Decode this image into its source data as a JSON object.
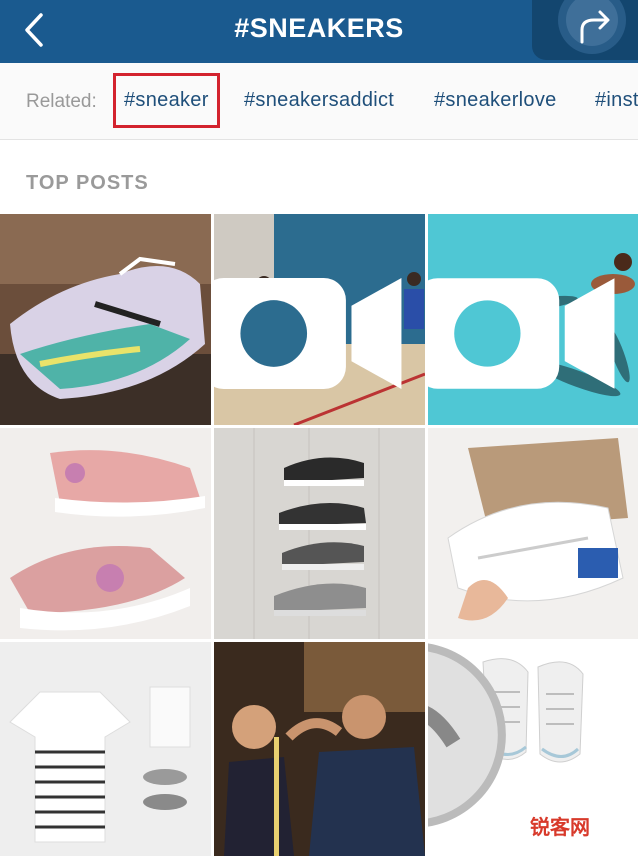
{
  "header": {
    "title": "#SNEAKERS",
    "back_icon": "chevron-left-icon",
    "share_icon": "share-arrow-icon"
  },
  "related": {
    "label": "Related:",
    "tags": [
      "#sneaker",
      "#sneakersaddict",
      "#sneakerlove",
      "#inst"
    ],
    "selected_index": 0
  },
  "section": {
    "title": "TOP POSTS"
  },
  "posts": [
    {
      "kind": "photo",
      "subject": "iridescent high-top sneakers"
    },
    {
      "kind": "video",
      "subject": "basketball gym"
    },
    {
      "kind": "video",
      "subject": "sharks in pool"
    },
    {
      "kind": "photo",
      "subject": "pink floral running shoes"
    },
    {
      "kind": "photo",
      "subject": "stacked black and grey sneakers"
    },
    {
      "kind": "photo",
      "subject": "white shell-toe sneakers"
    },
    {
      "kind": "photo",
      "subject": "striped tee flat lay"
    },
    {
      "kind": "photo",
      "subject": "tailor fitting suit"
    },
    {
      "kind": "photo",
      "subject": "white knit sneakers"
    }
  ],
  "watermark": {
    "text": "锐客网"
  },
  "colors": {
    "header": "#1a5a8f",
    "tag": "#1f4f7a",
    "highlight": "#d3232e"
  }
}
